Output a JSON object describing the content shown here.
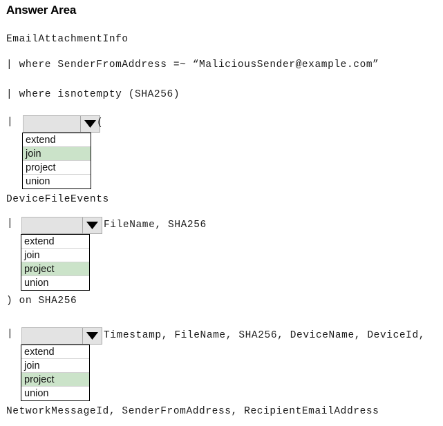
{
  "page": {
    "title": "Answer Area"
  },
  "query": {
    "table_line": "EmailAttachmentInfo",
    "line_where_sender": "| where SenderFromAddress =~ “MaliciousSender@example.com”",
    "line_where_isnotempty": "| where isnotempty (SHA256)",
    "pipe_symbol": "|",
    "after_dropdown_1": "(",
    "line_devicefileevents": "DeviceFileEvents",
    "after_dropdown_2": "FileName, SHA256",
    "line_on_sha256": ") on SHA256",
    "after_dropdown_3": "Timestamp, FileName, SHA256, DeviceName, DeviceId,",
    "line_continuation": "NetworkMessageId, SenderFromAddress, RecipientEmailAddress"
  },
  "dropdowns": [
    {
      "name": "operator-dropdown-1",
      "value": "",
      "options": [
        {
          "label": "extend",
          "selected": false
        },
        {
          "label": "join",
          "selected": true
        },
        {
          "label": "project",
          "selected": false
        },
        {
          "label": "union",
          "selected": false
        }
      ]
    },
    {
      "name": "operator-dropdown-2",
      "value": "",
      "options": [
        {
          "label": "extend",
          "selected": false
        },
        {
          "label": "join",
          "selected": false
        },
        {
          "label": "project",
          "selected": true
        },
        {
          "label": "union",
          "selected": false
        }
      ]
    },
    {
      "name": "operator-dropdown-3",
      "value": "",
      "options": [
        {
          "label": "extend",
          "selected": false
        },
        {
          "label": "join",
          "selected": false
        },
        {
          "label": "project",
          "selected": true
        },
        {
          "label": "union",
          "selected": false
        }
      ]
    }
  ],
  "colors": {
    "selected_option_background": "#cbe3c9",
    "dropdown_background": "#e3e3e3",
    "list_border": "#000000",
    "text": "#1a1a1a"
  },
  "icons": {
    "dropdown_arrow": "chevron-down-icon"
  }
}
